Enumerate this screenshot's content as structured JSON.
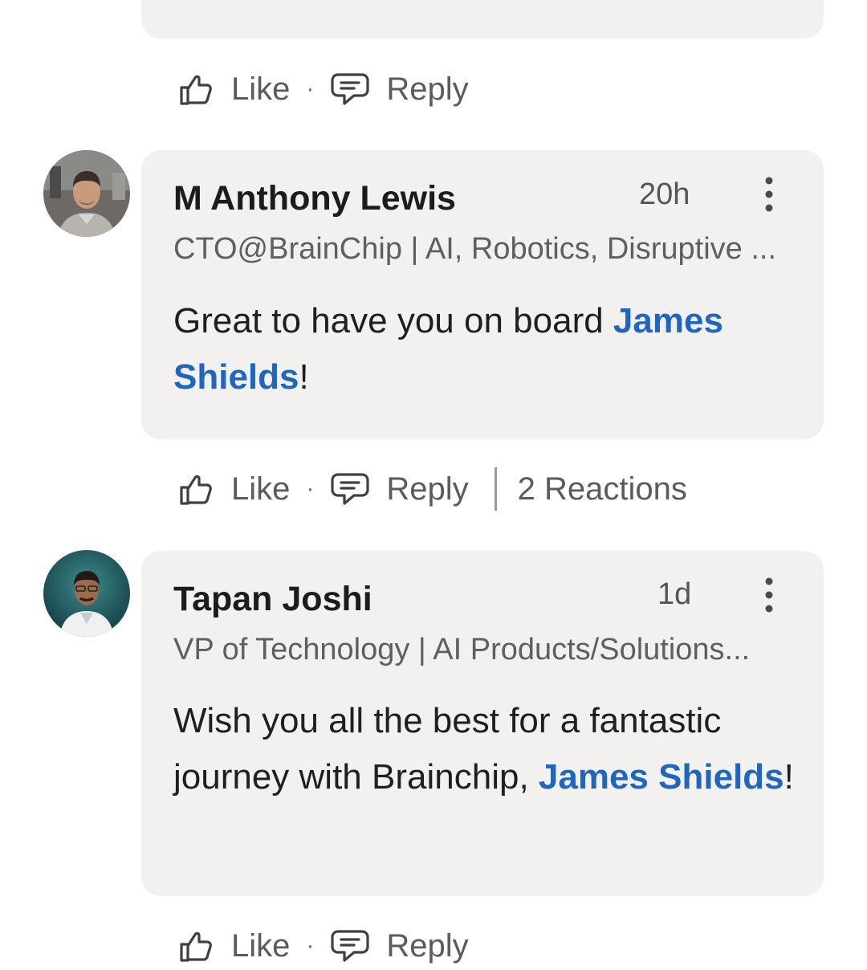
{
  "actions": {
    "like_label": "Like",
    "reply_label": "Reply",
    "separator": "·"
  },
  "comments": [
    {
      "author": "M Anthony Lewis",
      "time": "20h",
      "headline": "CTO@BrainChip | AI, Robotics, Disruptive ...",
      "text_before": "Great to have you on board ",
      "mention": "James Shields",
      "text_after": "!",
      "reactions": "2 Reactions"
    },
    {
      "author": "Tapan Joshi",
      "time": "1d",
      "headline": "VP of Technology | AI Products/Solutions...",
      "text_before": "Wish you all the best for a fantastic journey with Brainchip, ",
      "mention": "James Shields",
      "text_after": "!"
    }
  ],
  "colors": {
    "bubble": "#f2f1ef",
    "mention": "#1f66c1",
    "secondary_text": "#5f5f5f"
  },
  "icons": [
    "thumbs-up-icon",
    "speech-bubble-icon",
    "more-vertical-icon"
  ]
}
